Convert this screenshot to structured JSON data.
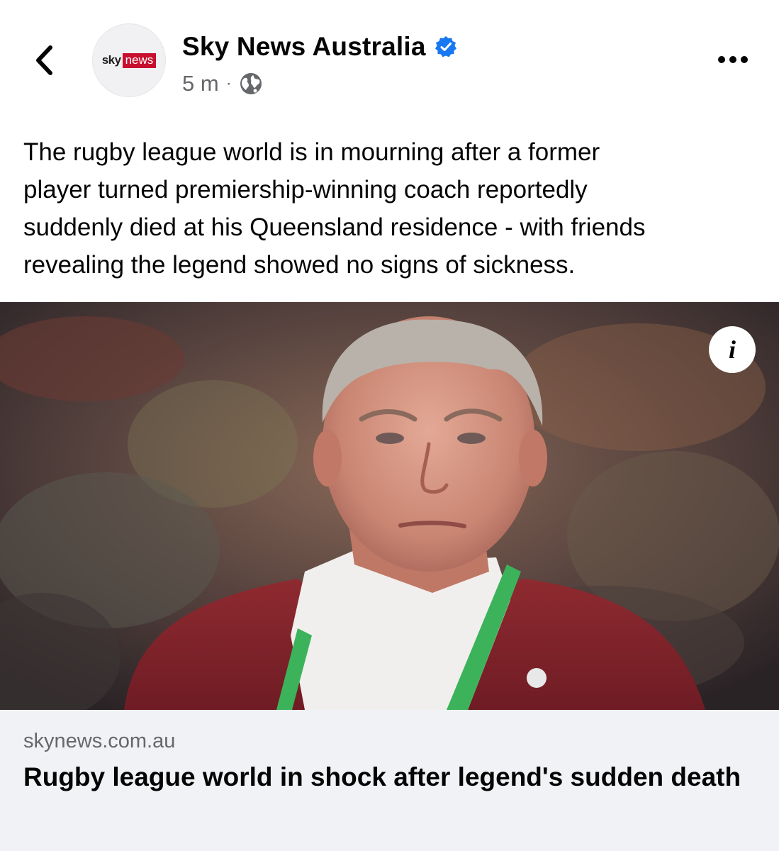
{
  "header": {
    "back_icon": "chevron-left-icon",
    "page_name": "Sky News Australia",
    "verified_icon": "verified-badge-icon",
    "time": "5 m",
    "separator": "·",
    "audience_icon": "globe-icon",
    "more_icon": "more-horizontal-icon",
    "logo": {
      "sky": "sky",
      "news": "news",
      "brand_color": "#c8102e"
    }
  },
  "post": {
    "text": "The rugby league world is in mourning after a former\nplayer turned premiership-winning coach reportedly\nsuddenly died at his Queensland residence - with friends\nrevealing the legend showed no signs of sickness.",
    "image_description_icon": "info-icon",
    "info_label": "i"
  },
  "link_preview": {
    "domain": "skynews.com.au",
    "title": "Rugby league world in shock after legend's sudden death"
  },
  "colors": {
    "verified_blue": "#1877f2",
    "secondary_text": "#65676b",
    "link_bg": "#f0f2f5"
  }
}
